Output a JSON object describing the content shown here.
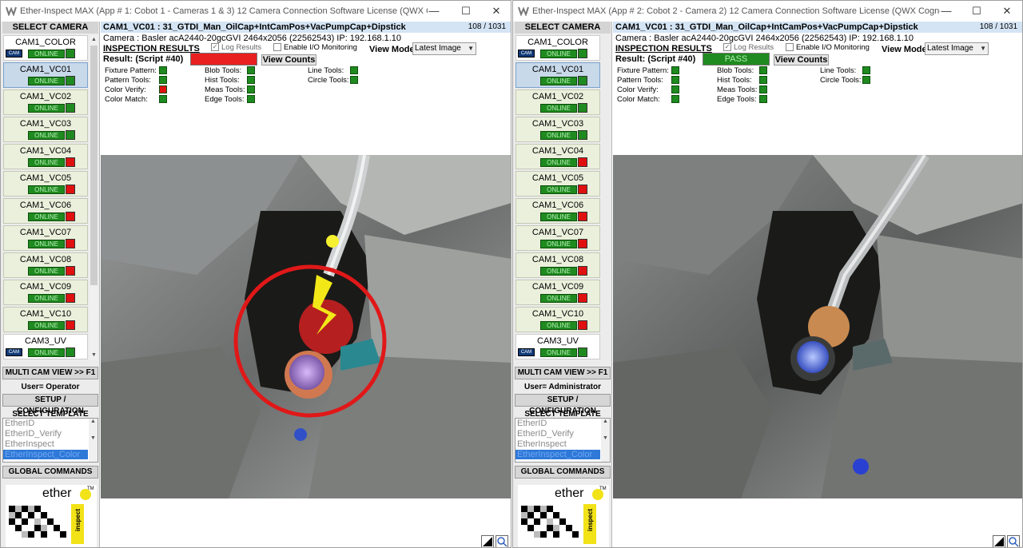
{
  "windows": [
    {
      "title": "Ether-Inspect MAX  (App # 1: Cobot 1 - Cameras 1 & 3)        12 Camera Connection Software License        (QWX C...",
      "sidebar": {
        "header": "SELECT CAMERA",
        "cameras": [
          {
            "name": "CAM1_COLOR",
            "status": "ONLINE",
            "indicator": "#1f8a1f",
            "has_cam_icon": true,
            "selected": false
          },
          {
            "name": "CAM1_VC01",
            "status": "ONLINE",
            "indicator": "#1f8a1f",
            "has_cam_icon": false,
            "selected": true
          },
          {
            "name": "CAM1_VC02",
            "status": "ONLINE",
            "indicator": "#1f8a1f",
            "has_cam_icon": false,
            "selected": false
          },
          {
            "name": "CAM1_VC03",
            "status": "ONLINE",
            "indicator": "#1f8a1f",
            "has_cam_icon": false,
            "selected": false
          },
          {
            "name": "CAM1_VC04",
            "status": "ONLINE",
            "indicator": "#e01010",
            "has_cam_icon": false,
            "selected": false
          },
          {
            "name": "CAM1_VC05",
            "status": "ONLINE",
            "indicator": "#e01010",
            "has_cam_icon": false,
            "selected": false
          },
          {
            "name": "CAM1_VC06",
            "status": "ONLINE",
            "indicator": "#e01010",
            "has_cam_icon": false,
            "selected": false
          },
          {
            "name": "CAM1_VC07",
            "status": "ONLINE",
            "indicator": "#e01010",
            "has_cam_icon": false,
            "selected": false
          },
          {
            "name": "CAM1_VC08",
            "status": "ONLINE",
            "indicator": "#e01010",
            "has_cam_icon": false,
            "selected": false
          },
          {
            "name": "CAM1_VC09",
            "status": "ONLINE",
            "indicator": "#e01010",
            "has_cam_icon": false,
            "selected": false
          },
          {
            "name": "CAM1_VC10",
            "status": "ONLINE",
            "indicator": "#e01010",
            "has_cam_icon": false,
            "selected": false
          },
          {
            "name": "CAM3_UV",
            "status": "ONLINE",
            "indicator": "#1f8a1f",
            "has_cam_icon": true,
            "selected": false
          }
        ],
        "multi_cam": "MULTI CAM VIEW >> F1",
        "user": "User= Operator",
        "setup": "SETUP / CONFIGURATION",
        "select_template": "SELECT TEMPLATE",
        "templates": [
          "EtherID",
          "EtherID_Verify",
          "EtherInspect",
          "EtherInspect_Color"
        ],
        "selected_template": "EtherInspect_Color",
        "global_commands": "GLOBAL COMMANDS",
        "logo_text": "ether",
        "logo_side_text": "inspect",
        "logo_tm": "TM"
      },
      "main": {
        "cam_title": "CAM1_VC01 :  31_GTDI_Man_OilCap+IntCamPos+VacPumpCap+Dipstick",
        "image_count": "108 / 1031",
        "camera_info": "Camera : Basler acA2440-20gcGVI 2464x2056 (22562543)  IP: 192.168.1.10",
        "inspection_results": "INSPECTION RESULTS",
        "log_results": "Log Results",
        "enable_io": "Enable I/O Monitoring",
        "view_mode_label": "View Mode",
        "view_mode_value": "Latest Image",
        "result_label": "Result: (Script #40)",
        "result_text": "",
        "result_color": "#e82020",
        "view_counts": "View Counts",
        "tools": {
          "fixture_pattern": {
            "label": "Fixture Pattern:",
            "color": "#1f8a1f"
          },
          "pattern_tools": {
            "label": "Pattern Tools:",
            "color": "#1f8a1f"
          },
          "color_verify": {
            "label": "Color Verify:",
            "color": "#e01010"
          },
          "color_match": {
            "label": "Color Match:",
            "color": "#1f8a1f"
          },
          "blob_tools": {
            "label": "Blob Tools:",
            "color": "#1f8a1f"
          },
          "hist_tools": {
            "label": "Hist Tools:",
            "color": "#1f8a1f"
          },
          "meas_tools": {
            "label": "Meas Tools:",
            "color": "#1f8a1f"
          },
          "edge_tools": {
            "label": "Edge Tools:",
            "color": "#1f8a1f"
          },
          "line_tools": {
            "label": "Line Tools:",
            "color": "#1f8a1f"
          },
          "circle_tools": {
            "label": "Circle Tools:",
            "color": "#1f8a1f"
          }
        }
      }
    },
    {
      "title": "Ether-Inspect MAX  (App # 2: Cobot 2 - Camera 2)        12 Camera Connection Software License        (QWX Cognex...",
      "sidebar": {
        "header": "SELECT CAMERA",
        "cameras": [
          {
            "name": "CAM1_COLOR",
            "status": "ONLINE",
            "indicator": "#1f8a1f",
            "has_cam_icon": true,
            "selected": false
          },
          {
            "name": "CAM1_VC01",
            "status": "ONLINE",
            "indicator": "#1f8a1f",
            "has_cam_icon": false,
            "selected": true
          },
          {
            "name": "CAM1_VC02",
            "status": "ONLINE",
            "indicator": "#1f8a1f",
            "has_cam_icon": false,
            "selected": false
          },
          {
            "name": "CAM1_VC03",
            "status": "ONLINE",
            "indicator": "#1f8a1f",
            "has_cam_icon": false,
            "selected": false
          },
          {
            "name": "CAM1_VC04",
            "status": "ONLINE",
            "indicator": "#e01010",
            "has_cam_icon": false,
            "selected": false
          },
          {
            "name": "CAM1_VC05",
            "status": "ONLINE",
            "indicator": "#e01010",
            "has_cam_icon": false,
            "selected": false
          },
          {
            "name": "CAM1_VC06",
            "status": "ONLINE",
            "indicator": "#e01010",
            "has_cam_icon": false,
            "selected": false
          },
          {
            "name": "CAM1_VC07",
            "status": "ONLINE",
            "indicator": "#e01010",
            "has_cam_icon": false,
            "selected": false
          },
          {
            "name": "CAM1_VC08",
            "status": "ONLINE",
            "indicator": "#e01010",
            "has_cam_icon": false,
            "selected": false
          },
          {
            "name": "CAM1_VC09",
            "status": "ONLINE",
            "indicator": "#e01010",
            "has_cam_icon": false,
            "selected": false
          },
          {
            "name": "CAM1_VC10",
            "status": "ONLINE",
            "indicator": "#e01010",
            "has_cam_icon": false,
            "selected": false
          },
          {
            "name": "CAM3_UV",
            "status": "ONLINE",
            "indicator": "#1f8a1f",
            "has_cam_icon": true,
            "selected": false
          }
        ],
        "multi_cam": "MULTI CAM VIEW >> F1",
        "user": "User= Administrator",
        "setup": "SETUP / CONFIGURATION",
        "select_template": "SELECT TEMPLATE",
        "templates": [
          "EtherID",
          "EtherID_Verify",
          "EtherInspect",
          "EtherInspect_Color"
        ],
        "selected_template": "EtherInspect_Color",
        "global_commands": "GLOBAL COMMANDS",
        "logo_text": "ether",
        "logo_side_text": "inspect",
        "logo_tm": "TM"
      },
      "main": {
        "cam_title": "CAM1_VC01 :  31_GTDI_Man_OilCap+IntCamPos+VacPumpCap+Dipstick",
        "image_count": "108 / 1031",
        "camera_info": "Camera : Basler acA2440-20gcGVI 2464x2056 (22562543)  IP: 192.168.1.10",
        "inspection_results": "INSPECTION RESULTS",
        "log_results": "Log Results",
        "enable_io": "Enable I/O Monitoring",
        "view_mode_label": "View Mode",
        "view_mode_value": "Latest Image",
        "result_label": "Result: (Script #40)",
        "result_text": "PASS",
        "result_color": "#1f8a1f",
        "view_counts": "View Counts",
        "tools": {
          "fixture_pattern": {
            "label": "Fixture Pattern:",
            "color": "#1f8a1f"
          },
          "pattern_tools": {
            "label": "Pattern Tools:",
            "color": "#1f8a1f"
          },
          "color_verify": {
            "label": "Color Verify:",
            "color": "#1f8a1f"
          },
          "color_match": {
            "label": "Color Match:",
            "color": "#1f8a1f"
          },
          "blob_tools": {
            "label": "Blob Tools:",
            "color": "#1f8a1f"
          },
          "hist_tools": {
            "label": "Hist Tools:",
            "color": "#1f8a1f"
          },
          "meas_tools": {
            "label": "Meas Tools:",
            "color": "#1f8a1f"
          },
          "edge_tools": {
            "label": "Edge Tools:",
            "color": "#1f8a1f"
          },
          "line_tools": {
            "label": "Line Tools:",
            "color": "#1f8a1f"
          },
          "circle_tools": {
            "label": "Circle Tools:",
            "color": "#1f8a1f"
          }
        }
      }
    }
  ],
  "window_controls": {
    "minimize": "—",
    "maximize": "☐",
    "close": "✕"
  }
}
